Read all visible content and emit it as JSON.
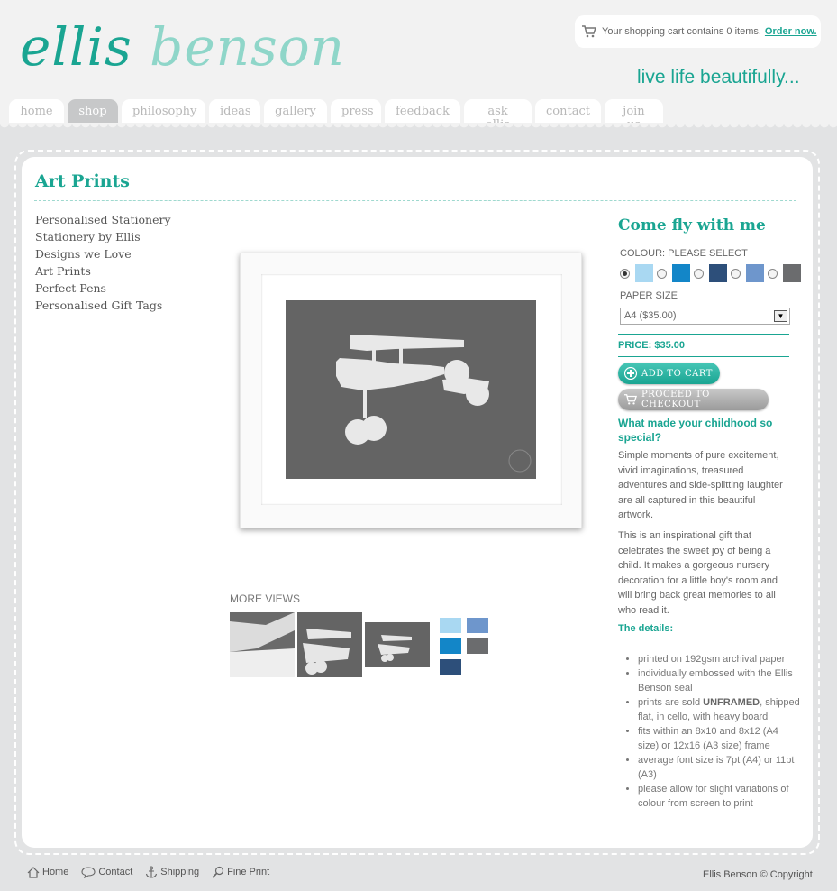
{
  "brand": {
    "logo_part1": "ellis",
    "logo_part2": " benson",
    "tagline": "live life beautifully..."
  },
  "cart": {
    "text": "Your shopping cart contains 0 items.",
    "link": "Order now."
  },
  "nav": {
    "tabs": [
      "home",
      "shop",
      "philosophy",
      "ideas",
      "gallery",
      "press",
      "feedback",
      "ask ellis",
      "contact",
      "join us"
    ],
    "active": "shop"
  },
  "page": {
    "title": "Art Prints"
  },
  "sidebar": {
    "items": [
      "Personalised Stationery",
      "Stationery by Ellis",
      "Designs we Love",
      "Art Prints",
      "Perfect Pens",
      "Personalised Gift Tags"
    ]
  },
  "gallery": {
    "more_views_label": "MORE VIEWS"
  },
  "product": {
    "title": "Come fly with me",
    "colour_label": "COLOUR: PLEASE SELECT",
    "swatches": [
      "#a9d8f2",
      "#1386c8",
      "#2d4f7a",
      "#6e96cc",
      "#6b6c6e"
    ],
    "paper_size_label": "PAPER SIZE",
    "paper_size_value": "A4 ($35.00)",
    "price": "PRICE: $35.00",
    "add_to_cart": "ADD TO CART",
    "checkout": "PROCEED TO CHECKOUT",
    "question": "What made your childhood so special?",
    "para1": "Simple moments of pure excitement, vivid imaginations, treasured adventures and side-splitting laughter are all captured in this beautiful artwork.",
    "para2": "This is an inspirational gift that celebrates the sweet joy of being a child. It makes a gorgeous nursery decoration for a little boy's room and will bring back great memories to all who read it.",
    "details_label": "The details:",
    "details": {
      "d1": "printed on 192gsm archival paper",
      "d2": "individually embossed with the Ellis Benson seal",
      "d3_pre": "prints are sold ",
      "d3_bold": "UNFRAMED",
      "d3_post": ", shipped flat, in cello, with heavy board",
      "d4": "fits within an 8x10 and 8x12 (A4 size) or 12x16 (A3 size) frame",
      "d5": "average font size is 7pt (A4) or 11pt (A3)",
      "d6": "please allow for slight variations of colour from screen to print"
    }
  },
  "footer": {
    "home": "Home",
    "contact": "Contact",
    "shipping": "Shipping",
    "fine_print": "Fine Print",
    "copyright": "Ellis Benson © Copyright"
  }
}
